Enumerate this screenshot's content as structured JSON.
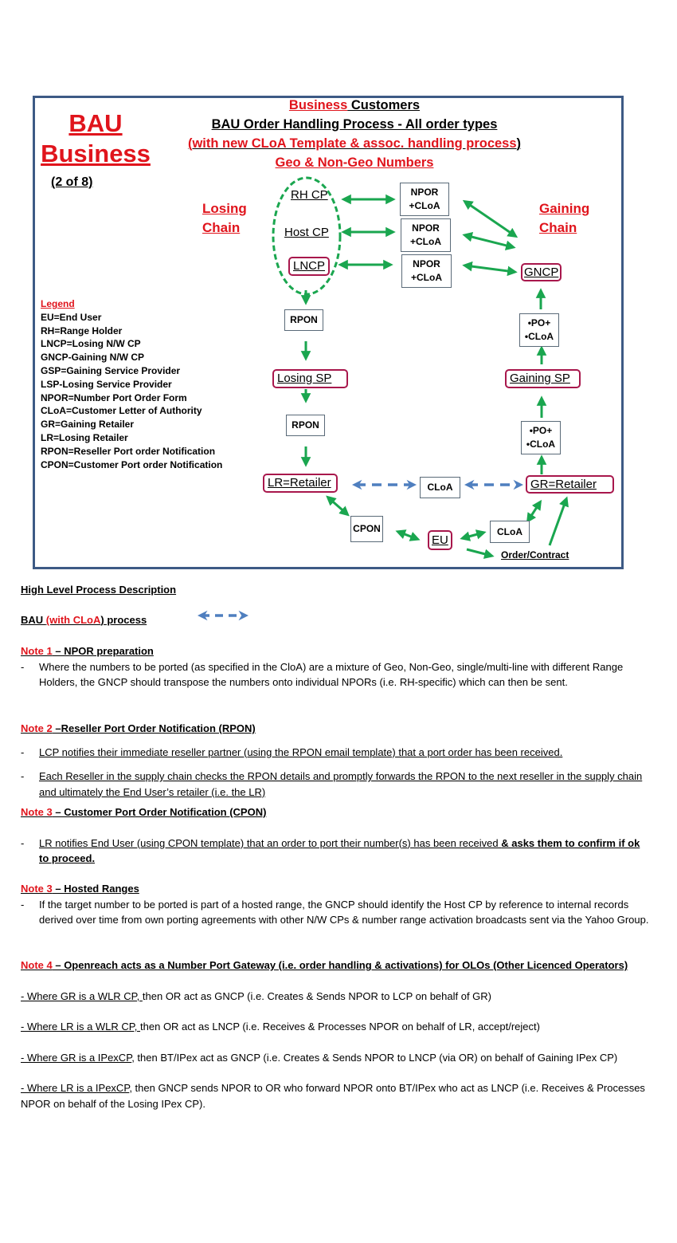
{
  "header": {
    "bau_title_line1": "BAU",
    "bau_title_line2": "Business",
    "page_count": "(2 of 8)",
    "title_line1_red": "Business",
    "title_line1_black": " Customers",
    "title_line2": "BAU Order Handling Process - All order types",
    "title_line3_open": "(",
    "title_line3_red": "with new CLoA Template & assoc. handling process",
    "title_line3_close": ")",
    "title_line4": "Geo & Non-Geo Numbers"
  },
  "diagram": {
    "losing_chain_line1": "Losing",
    "losing_chain_line2": "Chain",
    "gaining_chain_line1": "Gaining",
    "gaining_chain_line2": "Chain",
    "nodes": {
      "rh_cp": "RH CP",
      "host_cp": "Host CP",
      "lncp": "LNCP",
      "gncp": "GNCP",
      "losing_sp": "Losing SP",
      "gaining_sp": "Gaining SP",
      "lr_retailer": "LR=Retailer",
      "gr_retailer": "GR=Retailer",
      "eu": "EU",
      "order_contract": "Order/Contract"
    },
    "boxes": {
      "npor_line1": "NPOR",
      "npor_line2": "+CLoA",
      "rpon": "RPON",
      "po_line1": "•PO+",
      "po_line2": "•CLoA",
      "cloa": "CLoA",
      "cpon": "CPON"
    },
    "colors": {
      "green_arrow": "#1aa64f",
      "blue_dashed_arrow": "#4f7fbf",
      "node_border": "#a8174c",
      "frame_border": "#3d5a85",
      "red_text": "#e0141c"
    }
  },
  "legend": {
    "title": "Legend",
    "items": [
      "EU=End User",
      "RH=Range Holder",
      "LNCP=Losing N/W CP",
      "GNCP-Gaining N/W CP",
      "GSP=Gaining Service Provider",
      "LSP-Losing Service Provider",
      "NPOR=Number Port Order Form",
      "CLoA=Customer Letter of Authority",
      "GR=Gaining Retailer",
      "LR=Losing Retailer",
      "RPON=Reseller Port order Notification",
      "CPON=Customer Port order Notification"
    ]
  },
  "description": {
    "heading": "High Level Process Description",
    "bau_prefix": "BAU ",
    "bau_red": "(with CLoA",
    "bau_suffix": ") process",
    "note1": {
      "label": "Note 1",
      "title": " – NPOR preparation",
      "bullets": [
        "Where the numbers to be ported (as specified in the CloA) are a mixture of Geo, Non-Geo, single/multi-line with different Range Holders, the GNCP should transpose the numbers onto individual NPORs (i.e. RH-specific) which can then be sent."
      ]
    },
    "note2": {
      "label": "Note 2",
      "title": " –Reseller Port Order Notification (RPON)",
      "bullets": [
        "LCP notifies their immediate reseller partner (using the RPON email template) that a port order has been received.",
        "Each Reseller in the supply chain checks the RPON details and promptly forwards the RPON to the next reseller in the supply chain and ultimately the End User’s retailer (i.e. the LR)"
      ]
    },
    "note3a": {
      "label": "Note 3",
      "title": " – Customer Port Order Notification (CPON)",
      "bullet_normal": "LR notifies End User (using CPON template) that an order to port their number(s) has been received ",
      "bullet_bold": "& asks them to confirm if ok to proceed."
    },
    "note3b": {
      "label": "Note 3",
      "title": " – Hosted Ranges",
      "bullets": [
        "If the target number to be ported is part of a hosted range, the GNCP should identify the Host CP by reference to internal records derived over time from own porting agreements with other N/W CPs & number range activation broadcasts sent via the Yahoo Group."
      ]
    },
    "note4": {
      "label": "Note 4",
      "title": " – Openreach acts as a Number Port Gateway (i.e. order handling & activations) for OLOs (Other Licenced Operators)",
      "items": [
        {
          "underlined": " - Where GR is a WLR CP, ",
          "rest": "then OR act as GNCP (i.e. Creates & Sends NPOR to LCP on behalf of GR)"
        },
        {
          "underlined": " - Where LR is a WLR CP, ",
          "rest": "then OR act as LNCP (i.e. Receives & Processes NPOR on behalf of LR, accept/reject)"
        },
        {
          "underlined": " - Where GR is a IPexCP",
          "rest": ", then BT/IPex act as GNCP (i.e. Creates & Sends NPOR to LNCP (via OR) on behalf of Gaining IPex CP)"
        },
        {
          "underlined": "- Where LR is a IPexCP",
          "rest": ", then GNCP sends NPOR to OR who forward NPOR onto BT/IPex who act as LNCP (i.e. Receives & Processes NPOR on behalf of the Losing IPex CP)."
        }
      ]
    }
  }
}
